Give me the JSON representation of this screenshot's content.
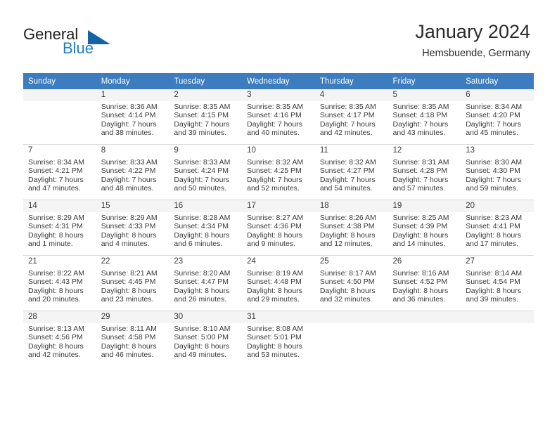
{
  "brand": {
    "name_part1": "General",
    "name_part2": "Blue",
    "accent_color": "#1463a5",
    "text_color": "#231f20"
  },
  "header": {
    "title": "January 2024",
    "subtitle": "Hemsbuende, Germany"
  },
  "calendar": {
    "header_bg": "#3c7cbf",
    "header_text_color": "#ffffff",
    "weekday_headers": [
      "Sunday",
      "Monday",
      "Tuesday",
      "Wednesday",
      "Thursday",
      "Friday",
      "Saturday"
    ],
    "weeks": [
      [
        {
          "day": "",
          "sunrise": "",
          "sunset": "",
          "daylight_line1": "",
          "daylight_line2": ""
        },
        {
          "day": "1",
          "sunrise": "Sunrise: 8:36 AM",
          "sunset": "Sunset: 4:14 PM",
          "daylight_line1": "Daylight: 7 hours",
          "daylight_line2": "and 38 minutes."
        },
        {
          "day": "2",
          "sunrise": "Sunrise: 8:35 AM",
          "sunset": "Sunset: 4:15 PM",
          "daylight_line1": "Daylight: 7 hours",
          "daylight_line2": "and 39 minutes."
        },
        {
          "day": "3",
          "sunrise": "Sunrise: 8:35 AM",
          "sunset": "Sunset: 4:16 PM",
          "daylight_line1": "Daylight: 7 hours",
          "daylight_line2": "and 40 minutes."
        },
        {
          "day": "4",
          "sunrise": "Sunrise: 8:35 AM",
          "sunset": "Sunset: 4:17 PM",
          "daylight_line1": "Daylight: 7 hours",
          "daylight_line2": "and 42 minutes."
        },
        {
          "day": "5",
          "sunrise": "Sunrise: 8:35 AM",
          "sunset": "Sunset: 4:18 PM",
          "daylight_line1": "Daylight: 7 hours",
          "daylight_line2": "and 43 minutes."
        },
        {
          "day": "6",
          "sunrise": "Sunrise: 8:34 AM",
          "sunset": "Sunset: 4:20 PM",
          "daylight_line1": "Daylight: 7 hours",
          "daylight_line2": "and 45 minutes."
        }
      ],
      [
        {
          "day": "7",
          "sunrise": "Sunrise: 8:34 AM",
          "sunset": "Sunset: 4:21 PM",
          "daylight_line1": "Daylight: 7 hours",
          "daylight_line2": "and 47 minutes."
        },
        {
          "day": "8",
          "sunrise": "Sunrise: 8:33 AM",
          "sunset": "Sunset: 4:22 PM",
          "daylight_line1": "Daylight: 7 hours",
          "daylight_line2": "and 48 minutes."
        },
        {
          "day": "9",
          "sunrise": "Sunrise: 8:33 AM",
          "sunset": "Sunset: 4:24 PM",
          "daylight_line1": "Daylight: 7 hours",
          "daylight_line2": "and 50 minutes."
        },
        {
          "day": "10",
          "sunrise": "Sunrise: 8:32 AM",
          "sunset": "Sunset: 4:25 PM",
          "daylight_line1": "Daylight: 7 hours",
          "daylight_line2": "and 52 minutes."
        },
        {
          "day": "11",
          "sunrise": "Sunrise: 8:32 AM",
          "sunset": "Sunset: 4:27 PM",
          "daylight_line1": "Daylight: 7 hours",
          "daylight_line2": "and 54 minutes."
        },
        {
          "day": "12",
          "sunrise": "Sunrise: 8:31 AM",
          "sunset": "Sunset: 4:28 PM",
          "daylight_line1": "Daylight: 7 hours",
          "daylight_line2": "and 57 minutes."
        },
        {
          "day": "13",
          "sunrise": "Sunrise: 8:30 AM",
          "sunset": "Sunset: 4:30 PM",
          "daylight_line1": "Daylight: 7 hours",
          "daylight_line2": "and 59 minutes."
        }
      ],
      [
        {
          "day": "14",
          "sunrise": "Sunrise: 8:29 AM",
          "sunset": "Sunset: 4:31 PM",
          "daylight_line1": "Daylight: 8 hours",
          "daylight_line2": "and 1 minute."
        },
        {
          "day": "15",
          "sunrise": "Sunrise: 8:29 AM",
          "sunset": "Sunset: 4:33 PM",
          "daylight_line1": "Daylight: 8 hours",
          "daylight_line2": "and 4 minutes."
        },
        {
          "day": "16",
          "sunrise": "Sunrise: 8:28 AM",
          "sunset": "Sunset: 4:34 PM",
          "daylight_line1": "Daylight: 8 hours",
          "daylight_line2": "and 6 minutes."
        },
        {
          "day": "17",
          "sunrise": "Sunrise: 8:27 AM",
          "sunset": "Sunset: 4:36 PM",
          "daylight_line1": "Daylight: 8 hours",
          "daylight_line2": "and 9 minutes."
        },
        {
          "day": "18",
          "sunrise": "Sunrise: 8:26 AM",
          "sunset": "Sunset: 4:38 PM",
          "daylight_line1": "Daylight: 8 hours",
          "daylight_line2": "and 12 minutes."
        },
        {
          "day": "19",
          "sunrise": "Sunrise: 8:25 AM",
          "sunset": "Sunset: 4:39 PM",
          "daylight_line1": "Daylight: 8 hours",
          "daylight_line2": "and 14 minutes."
        },
        {
          "day": "20",
          "sunrise": "Sunrise: 8:23 AM",
          "sunset": "Sunset: 4:41 PM",
          "daylight_line1": "Daylight: 8 hours",
          "daylight_line2": "and 17 minutes."
        }
      ],
      [
        {
          "day": "21",
          "sunrise": "Sunrise: 8:22 AM",
          "sunset": "Sunset: 4:43 PM",
          "daylight_line1": "Daylight: 8 hours",
          "daylight_line2": "and 20 minutes."
        },
        {
          "day": "22",
          "sunrise": "Sunrise: 8:21 AM",
          "sunset": "Sunset: 4:45 PM",
          "daylight_line1": "Daylight: 8 hours",
          "daylight_line2": "and 23 minutes."
        },
        {
          "day": "23",
          "sunrise": "Sunrise: 8:20 AM",
          "sunset": "Sunset: 4:47 PM",
          "daylight_line1": "Daylight: 8 hours",
          "daylight_line2": "and 26 minutes."
        },
        {
          "day": "24",
          "sunrise": "Sunrise: 8:19 AM",
          "sunset": "Sunset: 4:48 PM",
          "daylight_line1": "Daylight: 8 hours",
          "daylight_line2": "and 29 minutes."
        },
        {
          "day": "25",
          "sunrise": "Sunrise: 8:17 AM",
          "sunset": "Sunset: 4:50 PM",
          "daylight_line1": "Daylight: 8 hours",
          "daylight_line2": "and 32 minutes."
        },
        {
          "day": "26",
          "sunrise": "Sunrise: 8:16 AM",
          "sunset": "Sunset: 4:52 PM",
          "daylight_line1": "Daylight: 8 hours",
          "daylight_line2": "and 36 minutes."
        },
        {
          "day": "27",
          "sunrise": "Sunrise: 8:14 AM",
          "sunset": "Sunset: 4:54 PM",
          "daylight_line1": "Daylight: 8 hours",
          "daylight_line2": "and 39 minutes."
        }
      ],
      [
        {
          "day": "28",
          "sunrise": "Sunrise: 8:13 AM",
          "sunset": "Sunset: 4:56 PM",
          "daylight_line1": "Daylight: 8 hours",
          "daylight_line2": "and 42 minutes."
        },
        {
          "day": "29",
          "sunrise": "Sunrise: 8:11 AM",
          "sunset": "Sunset: 4:58 PM",
          "daylight_line1": "Daylight: 8 hours",
          "daylight_line2": "and 46 minutes."
        },
        {
          "day": "30",
          "sunrise": "Sunrise: 8:10 AM",
          "sunset": "Sunset: 5:00 PM",
          "daylight_line1": "Daylight: 8 hours",
          "daylight_line2": "and 49 minutes."
        },
        {
          "day": "31",
          "sunrise": "Sunrise: 8:08 AM",
          "sunset": "Sunset: 5:01 PM",
          "daylight_line1": "Daylight: 8 hours",
          "daylight_line2": "and 53 minutes."
        },
        {
          "day": "",
          "sunrise": "",
          "sunset": "",
          "daylight_line1": "",
          "daylight_line2": ""
        },
        {
          "day": "",
          "sunrise": "",
          "sunset": "",
          "daylight_line1": "",
          "daylight_line2": ""
        },
        {
          "day": "",
          "sunrise": "",
          "sunset": "",
          "daylight_line1": "",
          "daylight_line2": ""
        }
      ]
    ]
  }
}
